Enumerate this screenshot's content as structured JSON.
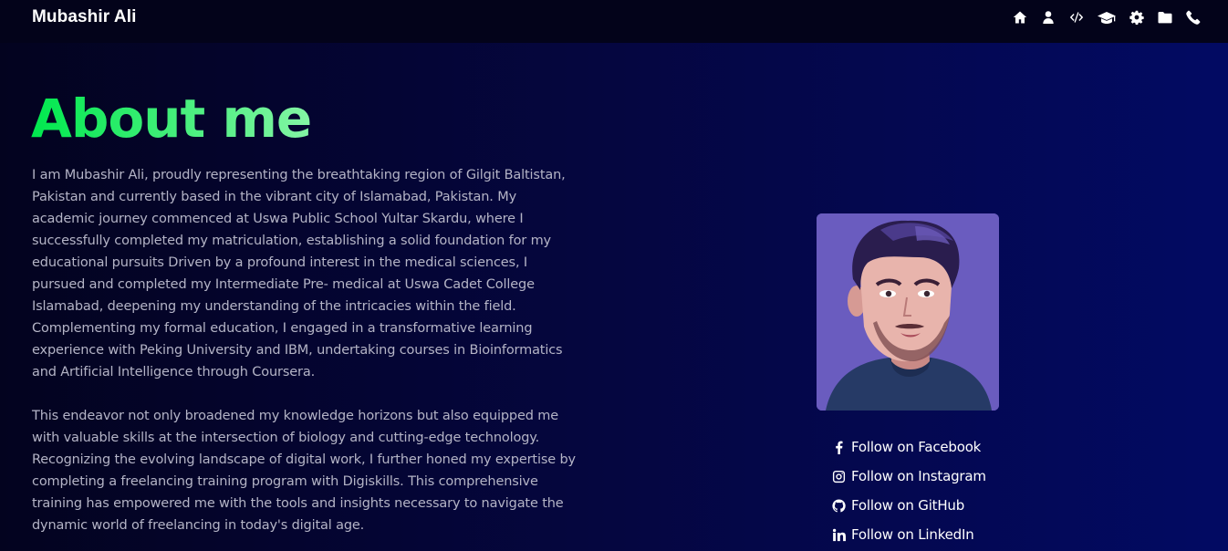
{
  "nav": {
    "brand": "Mubashir Ali",
    "icons": [
      "home-icon",
      "user-icon",
      "code-icon",
      "graduation-cap-icon",
      "gear-icon",
      "folder-icon",
      "phone-icon"
    ]
  },
  "about": {
    "title": "About me",
    "paragraphs": [
      "I am Mubashir Ali, proudly representing the breathtaking region of Gilgit Baltistan, Pakistan and currently based in the vibrant city of Islamabad, Pakistan. My academic journey commenced at Uswa Public School Yultar Skardu, where I successfully completed my matriculation, establishing a solid foundation for my educational pursuits Driven by a profound interest in the medical sciences, I pursued and completed my Intermediate Pre- medical at Uswa Cadet College Islamabad, deepening my understanding of the intricacies within the field. Complementing my formal education, I engaged in a transformative learning experience with Peking University and IBM, undertaking courses in Bioinformatics and Artificial Intelligence through Coursera.",
      "This endeavor not only broadened my knowledge horizons but also equipped me with valuable skills at the intersection of biology and cutting-edge technology. Recognizing the evolving landscape of digital work, I further honed my expertise by completing a freelancing training program with Digiskills. This comprehensive training has empowered me with the tools and insights necessary to navigate the dynamic world of freelancing in today's digital age."
    ]
  },
  "social": [
    {
      "icon": "facebook-icon",
      "label": "Follow on Facebook"
    },
    {
      "icon": "instagram-icon",
      "label": "Follow on Instagram"
    },
    {
      "icon": "github-icon",
      "label": "Follow on GitHub"
    },
    {
      "icon": "linkedin-icon",
      "label": "Follow on LinkedIn"
    }
  ],
  "colors": {
    "title_gradient_start": "#00e84e",
    "title_gradient_end": "#84f5a5",
    "background_left": "#03031f",
    "background_right": "#020a63",
    "body_text": "#b4b4c6"
  }
}
